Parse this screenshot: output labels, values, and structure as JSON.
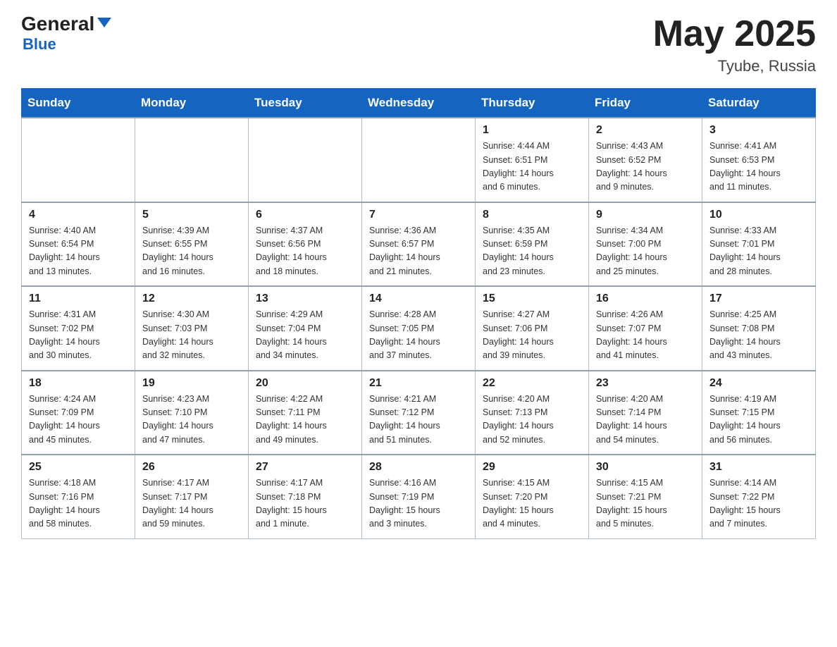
{
  "header": {
    "logo_general": "General",
    "logo_blue": "Blue",
    "title": "May 2025",
    "location": "Tyube, Russia"
  },
  "weekdays": [
    "Sunday",
    "Monday",
    "Tuesday",
    "Wednesday",
    "Thursday",
    "Friday",
    "Saturday"
  ],
  "weeks": [
    [
      {
        "day": "",
        "info": ""
      },
      {
        "day": "",
        "info": ""
      },
      {
        "day": "",
        "info": ""
      },
      {
        "day": "",
        "info": ""
      },
      {
        "day": "1",
        "info": "Sunrise: 4:44 AM\nSunset: 6:51 PM\nDaylight: 14 hours\nand 6 minutes."
      },
      {
        "day": "2",
        "info": "Sunrise: 4:43 AM\nSunset: 6:52 PM\nDaylight: 14 hours\nand 9 minutes."
      },
      {
        "day": "3",
        "info": "Sunrise: 4:41 AM\nSunset: 6:53 PM\nDaylight: 14 hours\nand 11 minutes."
      }
    ],
    [
      {
        "day": "4",
        "info": "Sunrise: 4:40 AM\nSunset: 6:54 PM\nDaylight: 14 hours\nand 13 minutes."
      },
      {
        "day": "5",
        "info": "Sunrise: 4:39 AM\nSunset: 6:55 PM\nDaylight: 14 hours\nand 16 minutes."
      },
      {
        "day": "6",
        "info": "Sunrise: 4:37 AM\nSunset: 6:56 PM\nDaylight: 14 hours\nand 18 minutes."
      },
      {
        "day": "7",
        "info": "Sunrise: 4:36 AM\nSunset: 6:57 PM\nDaylight: 14 hours\nand 21 minutes."
      },
      {
        "day": "8",
        "info": "Sunrise: 4:35 AM\nSunset: 6:59 PM\nDaylight: 14 hours\nand 23 minutes."
      },
      {
        "day": "9",
        "info": "Sunrise: 4:34 AM\nSunset: 7:00 PM\nDaylight: 14 hours\nand 25 minutes."
      },
      {
        "day": "10",
        "info": "Sunrise: 4:33 AM\nSunset: 7:01 PM\nDaylight: 14 hours\nand 28 minutes."
      }
    ],
    [
      {
        "day": "11",
        "info": "Sunrise: 4:31 AM\nSunset: 7:02 PM\nDaylight: 14 hours\nand 30 minutes."
      },
      {
        "day": "12",
        "info": "Sunrise: 4:30 AM\nSunset: 7:03 PM\nDaylight: 14 hours\nand 32 minutes."
      },
      {
        "day": "13",
        "info": "Sunrise: 4:29 AM\nSunset: 7:04 PM\nDaylight: 14 hours\nand 34 minutes."
      },
      {
        "day": "14",
        "info": "Sunrise: 4:28 AM\nSunset: 7:05 PM\nDaylight: 14 hours\nand 37 minutes."
      },
      {
        "day": "15",
        "info": "Sunrise: 4:27 AM\nSunset: 7:06 PM\nDaylight: 14 hours\nand 39 minutes."
      },
      {
        "day": "16",
        "info": "Sunrise: 4:26 AM\nSunset: 7:07 PM\nDaylight: 14 hours\nand 41 minutes."
      },
      {
        "day": "17",
        "info": "Sunrise: 4:25 AM\nSunset: 7:08 PM\nDaylight: 14 hours\nand 43 minutes."
      }
    ],
    [
      {
        "day": "18",
        "info": "Sunrise: 4:24 AM\nSunset: 7:09 PM\nDaylight: 14 hours\nand 45 minutes."
      },
      {
        "day": "19",
        "info": "Sunrise: 4:23 AM\nSunset: 7:10 PM\nDaylight: 14 hours\nand 47 minutes."
      },
      {
        "day": "20",
        "info": "Sunrise: 4:22 AM\nSunset: 7:11 PM\nDaylight: 14 hours\nand 49 minutes."
      },
      {
        "day": "21",
        "info": "Sunrise: 4:21 AM\nSunset: 7:12 PM\nDaylight: 14 hours\nand 51 minutes."
      },
      {
        "day": "22",
        "info": "Sunrise: 4:20 AM\nSunset: 7:13 PM\nDaylight: 14 hours\nand 52 minutes."
      },
      {
        "day": "23",
        "info": "Sunrise: 4:20 AM\nSunset: 7:14 PM\nDaylight: 14 hours\nand 54 minutes."
      },
      {
        "day": "24",
        "info": "Sunrise: 4:19 AM\nSunset: 7:15 PM\nDaylight: 14 hours\nand 56 minutes."
      }
    ],
    [
      {
        "day": "25",
        "info": "Sunrise: 4:18 AM\nSunset: 7:16 PM\nDaylight: 14 hours\nand 58 minutes."
      },
      {
        "day": "26",
        "info": "Sunrise: 4:17 AM\nSunset: 7:17 PM\nDaylight: 14 hours\nand 59 minutes."
      },
      {
        "day": "27",
        "info": "Sunrise: 4:17 AM\nSunset: 7:18 PM\nDaylight: 15 hours\nand 1 minute."
      },
      {
        "day": "28",
        "info": "Sunrise: 4:16 AM\nSunset: 7:19 PM\nDaylight: 15 hours\nand 3 minutes."
      },
      {
        "day": "29",
        "info": "Sunrise: 4:15 AM\nSunset: 7:20 PM\nDaylight: 15 hours\nand 4 minutes."
      },
      {
        "day": "30",
        "info": "Sunrise: 4:15 AM\nSunset: 7:21 PM\nDaylight: 15 hours\nand 5 minutes."
      },
      {
        "day": "31",
        "info": "Sunrise: 4:14 AM\nSunset: 7:22 PM\nDaylight: 15 hours\nand 7 minutes."
      }
    ]
  ]
}
